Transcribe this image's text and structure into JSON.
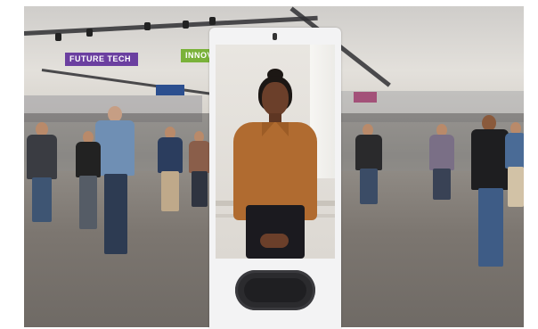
{
  "scene": {
    "banners": [
      {
        "text": "FUTURE TECH",
        "color": "#6b3fa0"
      },
      {
        "text": "INNOV",
        "color": "#7ab23a"
      },
      {
        "text": "",
        "color": "#2c4f8f"
      },
      {
        "text": "",
        "color": "#b0306a"
      }
    ]
  },
  "kiosk": {
    "frame_color": "#f3f3f4",
    "speaker_color": "#2b2b2e",
    "avatar": {
      "shirt_color": "#b06b30",
      "skirt_color": "#1b1a1f"
    }
  }
}
